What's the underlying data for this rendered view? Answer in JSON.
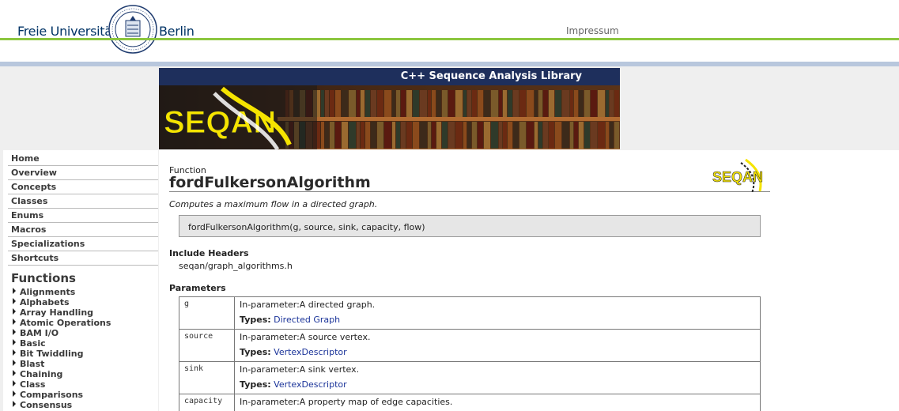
{
  "header": {
    "university_left": "Freie Universität",
    "university_right": "Berlin",
    "impressum": "Impressum"
  },
  "banner": {
    "title": "C++ Sequence Analysis Library",
    "logo_text": "SEQAN"
  },
  "sidebar": {
    "nav": [
      {
        "label": "Home"
      },
      {
        "label": "Overview"
      },
      {
        "label": "Concepts"
      },
      {
        "label": "Classes"
      },
      {
        "label": "Enums"
      },
      {
        "label": "Macros"
      },
      {
        "label": "Specializations"
      },
      {
        "label": "Shortcuts"
      }
    ],
    "functions_heading": "Functions",
    "function_groups": [
      {
        "label": "Alignments"
      },
      {
        "label": "Alphabets"
      },
      {
        "label": "Array Handling"
      },
      {
        "label": "Atomic Operations"
      },
      {
        "label": "BAM I/O"
      },
      {
        "label": "Basic"
      },
      {
        "label": "Bit Twiddling"
      },
      {
        "label": "Blast"
      },
      {
        "label": "Chaining"
      },
      {
        "label": "Class"
      },
      {
        "label": "Comparisons"
      },
      {
        "label": "Consensus"
      }
    ]
  },
  "main": {
    "kind": "Function",
    "title": "fordFulkersonAlgorithm",
    "summary": "Computes a maximum flow in a directed graph.",
    "signature": "fordFulkersonAlgorithm(g, source, sink, capacity, flow)",
    "include_heading": "Include Headers",
    "include_file": "seqan/graph_algorithms.h",
    "parameters_heading": "Parameters",
    "types_label": "Types:",
    "parameters": [
      {
        "name": "g",
        "desc": "In-parameter:A directed graph.",
        "type": "Directed Graph"
      },
      {
        "name": "source",
        "desc": "In-parameter:A source vertex.",
        "type": "VertexDescriptor"
      },
      {
        "name": "sink",
        "desc": "In-parameter:A sink vertex.",
        "type": "VertexDescriptor"
      },
      {
        "name": "capacity",
        "desc": "In-parameter:A property map of edge capacities.",
        "type": ""
      }
    ]
  },
  "colors": {
    "banner_bar": "#1e2f5c",
    "green_rule": "#8cc63f",
    "blue_band": "#b8c7dd",
    "link": "#1a3399",
    "logo_yellow": "#f5e400"
  }
}
